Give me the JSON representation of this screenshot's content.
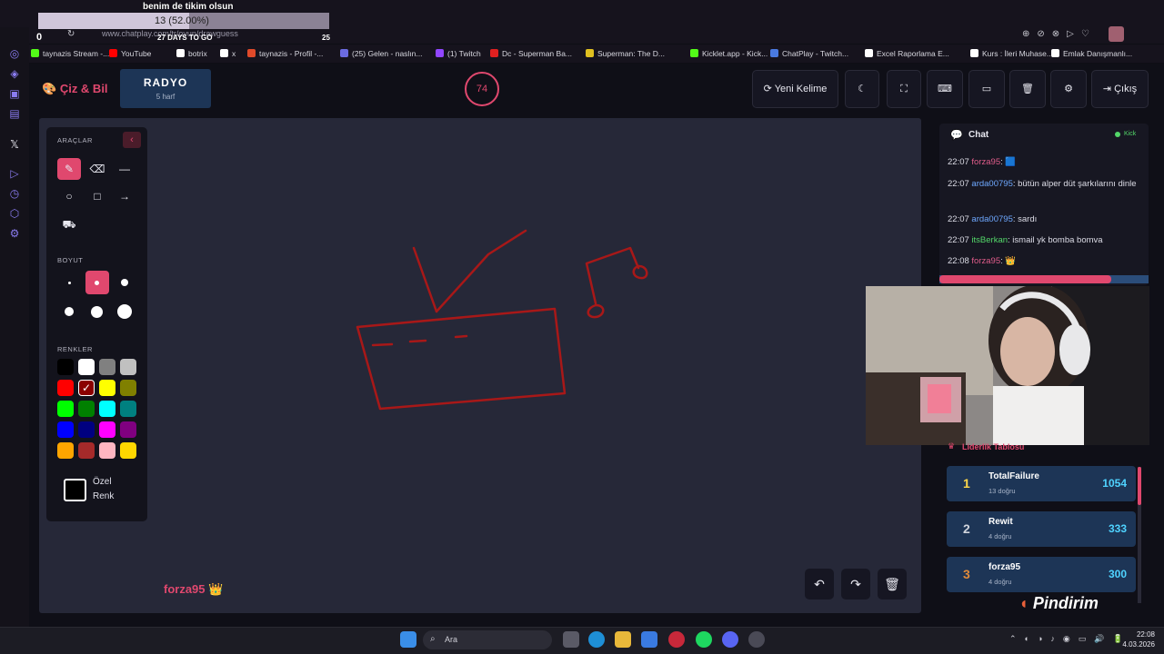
{
  "overlay": {
    "title": "benim de tikim olsun",
    "progress_text": "13 (52.00%)",
    "progress_fraction": 0.52,
    "counter_left": "0",
    "days_text": "27 DAYS TO GO",
    "counter_right": "25"
  },
  "browser": {
    "url": "www.chatplay.com/tr/oyun/drawguess",
    "bookmarks": [
      {
        "label": "taynazis Stream -...",
        "color": "#53fc18"
      },
      {
        "label": "YouTube",
        "color": "#ff0000"
      },
      {
        "label": "botrix",
        "color": "#ffffff"
      },
      {
        "label": "x",
        "color": "#ffffff"
      },
      {
        "label": "taynazis - Profil -...",
        "color": "#e04a2a"
      },
      {
        "label": "(25) Gelen - naslın...",
        "color": "#6b6be0"
      },
      {
        "label": "(1) Twitch",
        "color": "#9146ff"
      },
      {
        "label": "Dc - Superman Ba...",
        "color": "#e02020"
      },
      {
        "label": "Superman: The D...",
        "color": "#e0c020"
      },
      {
        "label": "Kicklet.app - Kick...",
        "color": "#53fc18"
      },
      {
        "label": "ChatPlay - Twitch...",
        "color": "#4a7ae0"
      },
      {
        "label": "Excel Raporlama E...",
        "color": "#ffffff"
      },
      {
        "label": "Kurs : İleri Muhase...",
        "color": "#ffffff"
      },
      {
        "label": "Emlak Danışmanlı...",
        "color": "#ffffff"
      }
    ]
  },
  "header": {
    "logo": "Çiz & Bil",
    "word": "RADYO",
    "word_hint": "5 harf",
    "timer": "74",
    "new_word": "Yeni Kelime",
    "exit": "Çıkış",
    "icons": [
      "moon-icon",
      "fullscreen-icon",
      "keyboard-icon",
      "archive-icon",
      "trash-icon",
      "gear-icon"
    ]
  },
  "tools": {
    "section_tools": "ARAÇLAR",
    "section_size": "BOYUT",
    "section_colors": "RENKLER",
    "custom_color": "Özel Renk",
    "colors": [
      "#000000",
      "#ffffff",
      "#808080",
      "#c0c0c0",
      "#ff0000",
      "#8b0000",
      "#ffff00",
      "#808000",
      "#00ff00",
      "#008000",
      "#00ffff",
      "#008080",
      "#0000ff",
      "#000080",
      "#ff00ff",
      "#800080",
      "#ffa500",
      "#a52a2a",
      "#ffb6c1",
      "#ffd700"
    ],
    "selected_color": "#8b0000"
  },
  "drawer": {
    "name": "forza95",
    "emoji": "👑"
  },
  "chat": {
    "title": "Chat",
    "platform": "Kick",
    "messages": [
      {
        "time": "22:07",
        "user": "forza95",
        "user_color": "#e05c8a",
        "text": "🟦"
      },
      {
        "time": "22:07",
        "user": "arda00795",
        "user_color": "#6ea8ff",
        "text": "bütün alper düt şarkılarını dinle"
      },
      {
        "time": "22:07",
        "user": "arda00795",
        "user_color": "#6ea8ff",
        "text": "sardı"
      },
      {
        "time": "22:07",
        "user": "itsBerkan",
        "user_color": "#53d769",
        "text": "ismail yk bomba bomva"
      },
      {
        "time": "22:08",
        "user": "forza95",
        "user_color": "#e05c8a",
        "text": "👑"
      }
    ],
    "scroll_fraction": 0.82
  },
  "leaderboard": {
    "title": "Liderlik Tablosu",
    "entries": [
      {
        "rank": "1",
        "name": "TotalFailure",
        "sub": "13 doğru",
        "score": "1054",
        "rank_color": "#ffd84a"
      },
      {
        "rank": "2",
        "name": "Rewit",
        "sub": "4 doğru",
        "score": "333",
        "rank_color": "#d0d4dc"
      },
      {
        "rank": "3",
        "name": "forza95",
        "sub": "4 doğru",
        "score": "300",
        "rank_color": "#e08a3a"
      }
    ]
  },
  "brand": "Pindirim",
  "taskbar": {
    "search": "Ara",
    "time": "22:08",
    "date": "4.03.2026"
  }
}
